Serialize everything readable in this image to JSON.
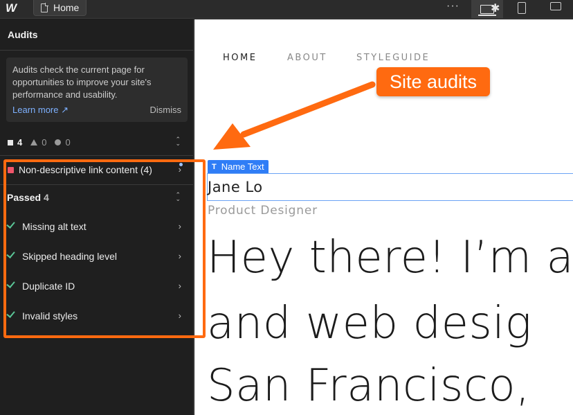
{
  "topbar": {
    "page_tab_label": "Home",
    "more_label": "···"
  },
  "panel": {
    "title": "Audits",
    "info": {
      "text": "Audits check the current page for opportunities to improve your site's performance and usability.",
      "learn_more": "Learn more ↗",
      "dismiss": "Dismiss"
    },
    "counts": {
      "errors": "4",
      "warnings": "0",
      "suggestions": "0"
    },
    "issues": [
      {
        "label": "Non-descriptive link content (4)"
      }
    ],
    "passed": {
      "title": "Passed",
      "count": "4",
      "items": [
        {
          "label": "Missing alt text"
        },
        {
          "label": "Skipped heading level"
        },
        {
          "label": "Duplicate ID"
        },
        {
          "label": "Invalid styles"
        }
      ]
    }
  },
  "canvas": {
    "nav": [
      "HOME",
      "ABOUT",
      "STYLEGUIDE"
    ],
    "selection_tag": "Name Text",
    "name": "Jane Lo",
    "role": "Product Designer",
    "hero_lines": [
      "Hey there! I’m a",
      "and web desig",
      "San Francisco,"
    ]
  },
  "annotation": {
    "callout": "Site audits",
    "color": "#ff6a10"
  },
  "colors": {
    "accent_blue": "#2f7df6",
    "error_red": "#f0556a",
    "pass_green": "#5ac596"
  }
}
